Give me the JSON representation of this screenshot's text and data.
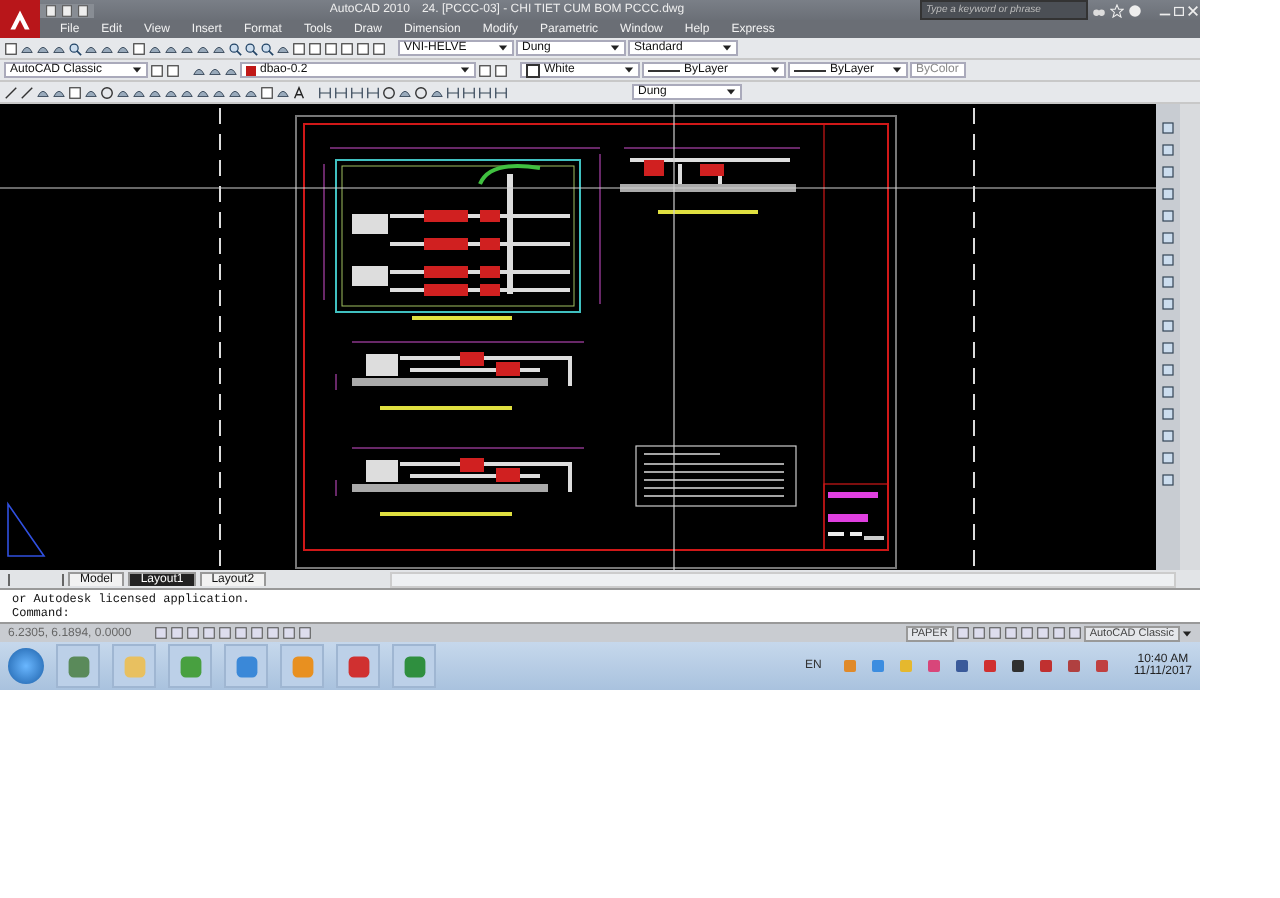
{
  "window": {
    "app_title": "AutoCAD 2010",
    "document_title": "24. [PCCC-03] - CHI TIET CUM BOM PCCC.dwg",
    "search": {
      "placeholder": "Type a keyword or phrase"
    }
  },
  "menu": [
    "File",
    "Edit",
    "View",
    "Insert",
    "Format",
    "Tools",
    "Draw",
    "Dimension",
    "Modify",
    "Parametric",
    "Window",
    "Help",
    "Express"
  ],
  "toolbar_1": {
    "dropdowns": [
      "VNI-HELVE",
      "Dung",
      "Standard"
    ]
  },
  "toolbar_2": {
    "workspace": "AutoCAD Classic",
    "layer": "dbao-0.2",
    "color_setting": "White",
    "linetype": "ByLayer",
    "lineweight": "ByLayer",
    "plot_style": "ByColor"
  },
  "toolbar_3": {
    "dropdown": "Dung"
  },
  "layout_tabs": [
    {
      "label": "Model",
      "selected": false
    },
    {
      "label": "Layout1",
      "selected": true
    },
    {
      "label": "Layout2",
      "selected": false
    }
  ],
  "command_lines": [
    "or Autodesk licensed application.",
    "Command:"
  ],
  "status_bar": {
    "coordinates": "6.2305, 6.1894, 0.0000",
    "space": "PAPER",
    "workspace": "AutoCAD Classic"
  },
  "taskbar": {
    "language": "EN",
    "time": "10:40 AM",
    "date": "11/11/2017"
  }
}
